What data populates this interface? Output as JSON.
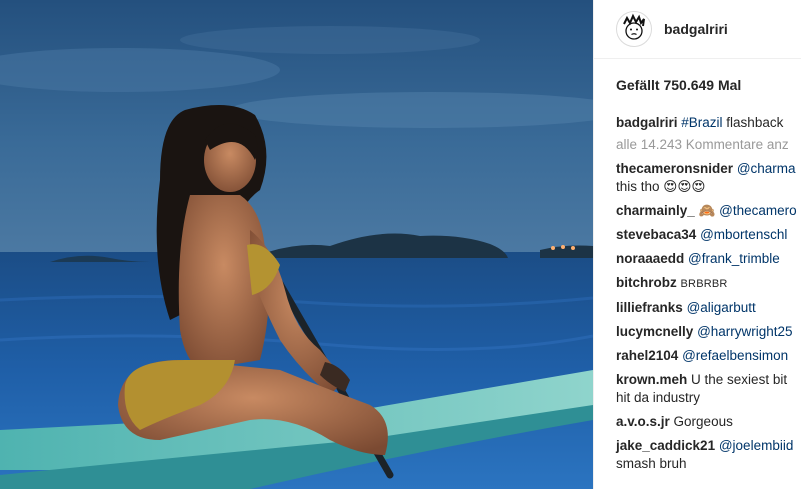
{
  "post": {
    "username": "badgalriri",
    "likes_text": "Gefällt 750.649 Mal",
    "caption": {
      "user": "badgalriri",
      "hashtag": "#Brazil",
      "text": " flashback"
    },
    "more_comments": "alle 14.243 Kommentare anz",
    "comments": [
      {
        "user": "thecameronsnider",
        "mention": "@charma",
        "text": "",
        "line2": "this tho 😍😍😍"
      },
      {
        "user": "charmainly_",
        "mention": "@thecamero",
        "text": "🙈 ",
        "line2": ""
      },
      {
        "user": "stevebaca34",
        "mention": "@mbortenschl",
        "text": "",
        "line2": ""
      },
      {
        "user": "noraaaedd",
        "mention": "@frank_trimble",
        "text": "",
        "line2": ""
      },
      {
        "user": "bitchrobz",
        "mention": "",
        "text": "BRBRBR",
        "line2": ""
      },
      {
        "user": "lilliefranks",
        "mention": "@aligarbutt",
        "text": "",
        "line2": ""
      },
      {
        "user": "lucymcnelly",
        "mention": "@harrywright25",
        "text": "",
        "line2": ""
      },
      {
        "user": "rahel2104",
        "mention": "@refaelbensimon",
        "text": "",
        "line2": ""
      },
      {
        "user": "krown.meh",
        "mention": "",
        "text": "U the sexiest bit",
        "line2": "hit da industry"
      },
      {
        "user": "a.v.o.s.jr",
        "mention": "",
        "text": "Gorgeous",
        "line2": ""
      },
      {
        "user": "jake_caddick21",
        "mention": "@joelembiid",
        "text": "",
        "line2": "smash bruh"
      }
    ]
  }
}
